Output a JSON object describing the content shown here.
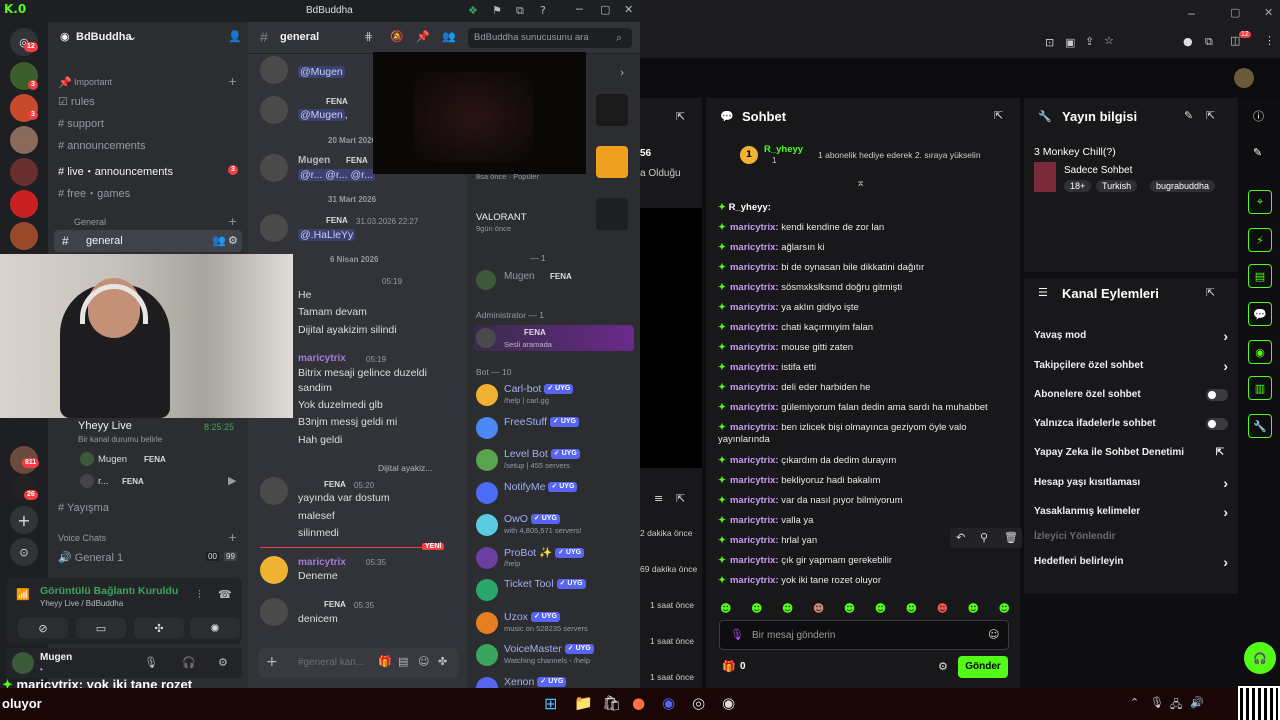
{
  "kick": {
    "badge_count": "12",
    "panes": {
      "chat_title": "Sohbet",
      "info_title": "Yayın bilgisi",
      "actions_title": "Kanal Eylemleri"
    },
    "left_pane": {
      "num": "56",
      "line": "a Olduğu"
    },
    "gift_banner": {
      "user": "R_yheyy",
      "count": "1",
      "text": "1 abonelik hediye ederek 2. sıraya yükselin"
    },
    "chat_top_user": "R_yheyy:",
    "chat_messages": [
      {
        "user": "maricytrix:",
        "text": "kendi kendine de zor lan"
      },
      {
        "user": "maricytrix:",
        "text": "ağlarsın ki"
      },
      {
        "user": "maricytrix:",
        "text": "bi de oynasan bile dikkatini dağıtır"
      },
      {
        "user": "maricytrix:",
        "text": "sösmxkslksmd doğru gitmişti"
      },
      {
        "user": "maricytrix:",
        "text": "ya aklın gidiyo işte"
      },
      {
        "user": "maricytrix:",
        "text": "chati kaçırmıyim falan"
      },
      {
        "user": "maricytrix:",
        "text": "mouse gitti zaten"
      },
      {
        "user": "maricytrix:",
        "text": "istifa etti"
      },
      {
        "user": "maricytrix:",
        "text": "deli eder harbiden he"
      },
      {
        "user": "maricytrix:",
        "text": "gülemiyorum falan dedin ama sardı ha muhabbet"
      },
      {
        "user": "maricytrix:",
        "text": "ben izlicek bişi olmayınca geziyom öyle valo yayınlarında"
      },
      {
        "user": "maricytrix:",
        "text": "çıkardım da dedim durayım"
      },
      {
        "user": "maricytrix:",
        "text": "bekliyoruz hadi bakalım"
      },
      {
        "user": "maricytrix:",
        "text": "var da nasıl pıyor bilmiyorum"
      },
      {
        "user": "maricytrix:",
        "text": "valla ya"
      },
      {
        "user": "maricytrix:",
        "text": "hrlal yan"
      },
      {
        "user": "maricytrix:",
        "text": "çık gir yapmam gerekebilir"
      },
      {
        "user": "maricytrix:",
        "text": "yok iki tane rozet oluyor"
      }
    ],
    "chat_input_placeholder": "Bir mesaj gönderin",
    "points": "0",
    "send_label": "Gönder",
    "stream_info": {
      "title": "3 Monkey Chill(?)",
      "category": "Sadece Sohbet",
      "tags": [
        "18+",
        "Turkish",
        "bugrabuddha"
      ]
    },
    "actions": [
      {
        "label": "Yavaş mod",
        "type": "chevron"
      },
      {
        "label": "Takipçilere özel sohbet",
        "type": "chevron"
      },
      {
        "label": "Abonelere özel sohbet",
        "type": "toggle"
      },
      {
        "label": "Yalnızca ifadelerle sohbet",
        "type": "toggle"
      },
      {
        "label": "Yapay Zeka ile Sohbet Denetimi",
        "type": "link"
      },
      {
        "label": "Hesap yaşı kısıtlaması",
        "type": "chevron"
      },
      {
        "label": "Yasaklanmış kelimeler",
        "type": "chevron"
      },
      {
        "label": "İzleyici Yönlendir",
        "type": "disabled"
      },
      {
        "label": "Hedefleri belirleyin",
        "type": "chevron"
      }
    ]
  },
  "discord": {
    "window_title": "BdBuddha",
    "server_name": "BdBuddha",
    "search_placeholder": "BdBuddha sunucusunu ara",
    "channel_header": "general",
    "badges": [
      "12",
      "3",
      "3"
    ],
    "categories": {
      "important": "Important",
      "general": "General",
      "voice": "Voice Chats"
    },
    "channels": {
      "rules": "rules",
      "support": "support",
      "announcements": "announcements",
      "live": "live・announcements",
      "live_badge": "3",
      "games": "free・games",
      "general": "general",
      "yayisma": "Yayışma",
      "general1": "General 1",
      "g1_a": "00",
      "g1_b": "99"
    },
    "server_badges": [
      "811",
      "26"
    ],
    "live_stage": {
      "title": "Yheyy Live",
      "subtitle": "Bir kanal durumu belirle",
      "time": "8:25:25"
    },
    "voice_members": [
      {
        "name": "Mugen",
        "tag": "FENA"
      },
      {
        "name": "r...",
        "tag": "FENA"
      }
    ],
    "voice_panel": {
      "status": "Görüntülü Bağlantı Kuruldu",
      "sub": "Yheyy Live / BdBuddha"
    },
    "user_panel": {
      "name": "Mugen",
      "status": "•"
    },
    "messages": {
      "m1_mention": "@Mugen",
      "m2_mention": "@Mugen",
      "m2_suffix": ",",
      "date1": "20 Mart 2026",
      "m3_name": "Mugen",
      "m3_text": "@r... @r... @r...",
      "date2": "31 Mart 2026",
      "m4_time": "31.03.2026 22:27",
      "m4_text": "@.HaLleYy",
      "date3": "6 Nisan 2026",
      "m5_time": "05:19",
      "m5_lines": [
        "He",
        "Tamam devam",
        "Dijital ayakizim silindi"
      ],
      "m6_name": "maricytrix",
      "m6_time": "05:19",
      "m6_lines": [
        "Bitrix mesaji gelince duzeldi",
        "sandim",
        "Yok duzelmedi glb",
        "B3njm messj geldi mi",
        "Hah geldi"
      ],
      "reply_preview": "Dijital ayakiz...",
      "m7_time": "05:20",
      "m7_lines": [
        "yayında var dostum",
        "malesef",
        "silinmedi"
      ],
      "new_label": "YENİ",
      "m8_name": "maricytrix",
      "m8_time": "05:35",
      "m8_text": "Deneme",
      "m9_time": "05:35",
      "m9_text": "denicem",
      "fena": "FENA",
      "composer_placeholder": "#general kan..."
    },
    "activity": {
      "popular": "8sa önce · Popüler",
      "valorant": "VALORANT",
      "valorant_time": "9gün önce"
    },
    "members": {
      "role1_header": "— 1",
      "role1_member": "Mugen",
      "admin_header": "Administrator — 1",
      "admin_sub": "Sesli aramada",
      "bot_header": "Bot — 10",
      "bots": [
        {
          "name": "Carl-bot",
          "sub": "/help | carl.gg",
          "color": "#f0b232"
        },
        {
          "name": "FreeStuff",
          "sub": "",
          "color": "#4b88f2"
        },
        {
          "name": "Level Bot",
          "sub": "/setup | 455 servers",
          "color": "#58a34d"
        },
        {
          "name": "NotifyMe",
          "sub": "",
          "color": "#4a6cf7"
        },
        {
          "name": "OwO",
          "sub": "with 4,805,571 servers!",
          "color": "#5ccbe0"
        },
        {
          "name": "ProBot ✨",
          "sub": "/help",
          "color": "#6b3fa0"
        },
        {
          "name": "Ticket Tool",
          "sub": "",
          "color": "#2aa66a"
        },
        {
          "name": "Uzox",
          "sub": "music on 528235 servers",
          "color": "#e67e22"
        },
        {
          "name": "VoiceMaster",
          "sub": "Watching channels - /help",
          "color": "#3ba55d"
        },
        {
          "name": "Xenon",
          "sub": "/help",
          "color": "#5865f2"
        }
      ],
      "bot_tag": "UYG"
    }
  },
  "stream_times": [
    "2 dakika önce",
    "69 dakika önce",
    "1 saat önce",
    "1 saat önce",
    "1 saat önce"
  ],
  "overlay": {
    "user": "maricytrix",
    "text": ": yok iki tane rozet",
    "text2": "oluyor"
  },
  "colors": {
    "kick_green": "#53fc18",
    "discord_bg": "#313338",
    "blurple": "#5865f2",
    "mention_red": "#f23f43"
  }
}
